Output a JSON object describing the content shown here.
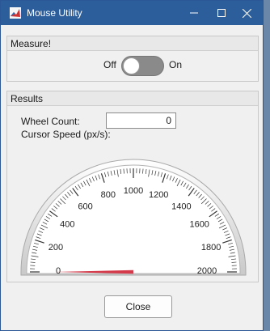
{
  "window": {
    "title": "Mouse Utility"
  },
  "measure_panel": {
    "title": "Measure!",
    "switch": {
      "off_label": "Off",
      "on_label": "On",
      "state": "Off"
    }
  },
  "results_panel": {
    "title": "Results",
    "wheel_count_label": "Wheel Count:",
    "wheel_count_value": "0",
    "cursor_speed_label": "Cursor Speed (px/s):",
    "gauge": {
      "min": 0,
      "max": 2000,
      "tick_labels": [
        "0",
        "200",
        "400",
        "600",
        "800",
        "1000",
        "1200",
        "1400",
        "1600",
        "1800",
        "2000"
      ],
      "value": 0,
      "needle_color": "#d43a4a"
    }
  },
  "close_button": {
    "label": "Close"
  },
  "colors": {
    "titlebar": "#2d5e9c",
    "app_icon": "#d03131"
  },
  "icons": {
    "app": "matlab-app-icon",
    "minimize": "minimize-icon",
    "maximize": "maximize-icon",
    "close": "close-icon"
  }
}
